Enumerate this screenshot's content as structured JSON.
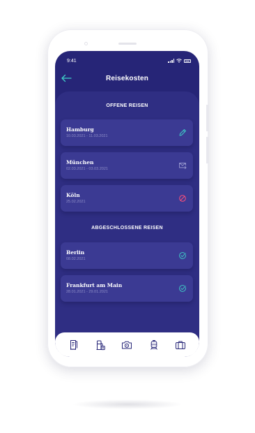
{
  "status": {
    "time": "9:41"
  },
  "header": {
    "title": "Reisekosten"
  },
  "sections": {
    "open": "OFFENE REISEN",
    "closed": "ABGESCHLOSSENE REISEN"
  },
  "open_trips": [
    {
      "name": "Hamburg",
      "dates": "10.03.2021 - 11.03.2021",
      "icon": "pencil-icon",
      "color": "#3fd0c8"
    },
    {
      "name": "München",
      "dates": "02.03.2021 - 03.03.2021",
      "icon": "mail-forward-icon",
      "color": "#9a9ad0"
    },
    {
      "name": "Köln",
      "dates": "25.02.2021",
      "icon": "blocked-icon",
      "color": "#ff4f7b"
    }
  ],
  "closed_trips": [
    {
      "name": "Berlin",
      "dates": "08.02.2021",
      "icon": "check-circle-icon",
      "color": "#3fd0c8"
    },
    {
      "name": "Frankfurt am Main",
      "dates": "28.01.2021 - 29.01.2021",
      "icon": "check-circle-icon",
      "color": "#3fd0c8"
    }
  ],
  "tabbar": {
    "icons": [
      "receipts-icon",
      "fuel-icon",
      "camera-icon",
      "train-icon",
      "suitcase-icon"
    ],
    "color": "#262577"
  },
  "colors": {
    "background": "#262577",
    "panel": "#2f2e83",
    "card": "#3b3a93",
    "accent": "#3fd0c8"
  }
}
